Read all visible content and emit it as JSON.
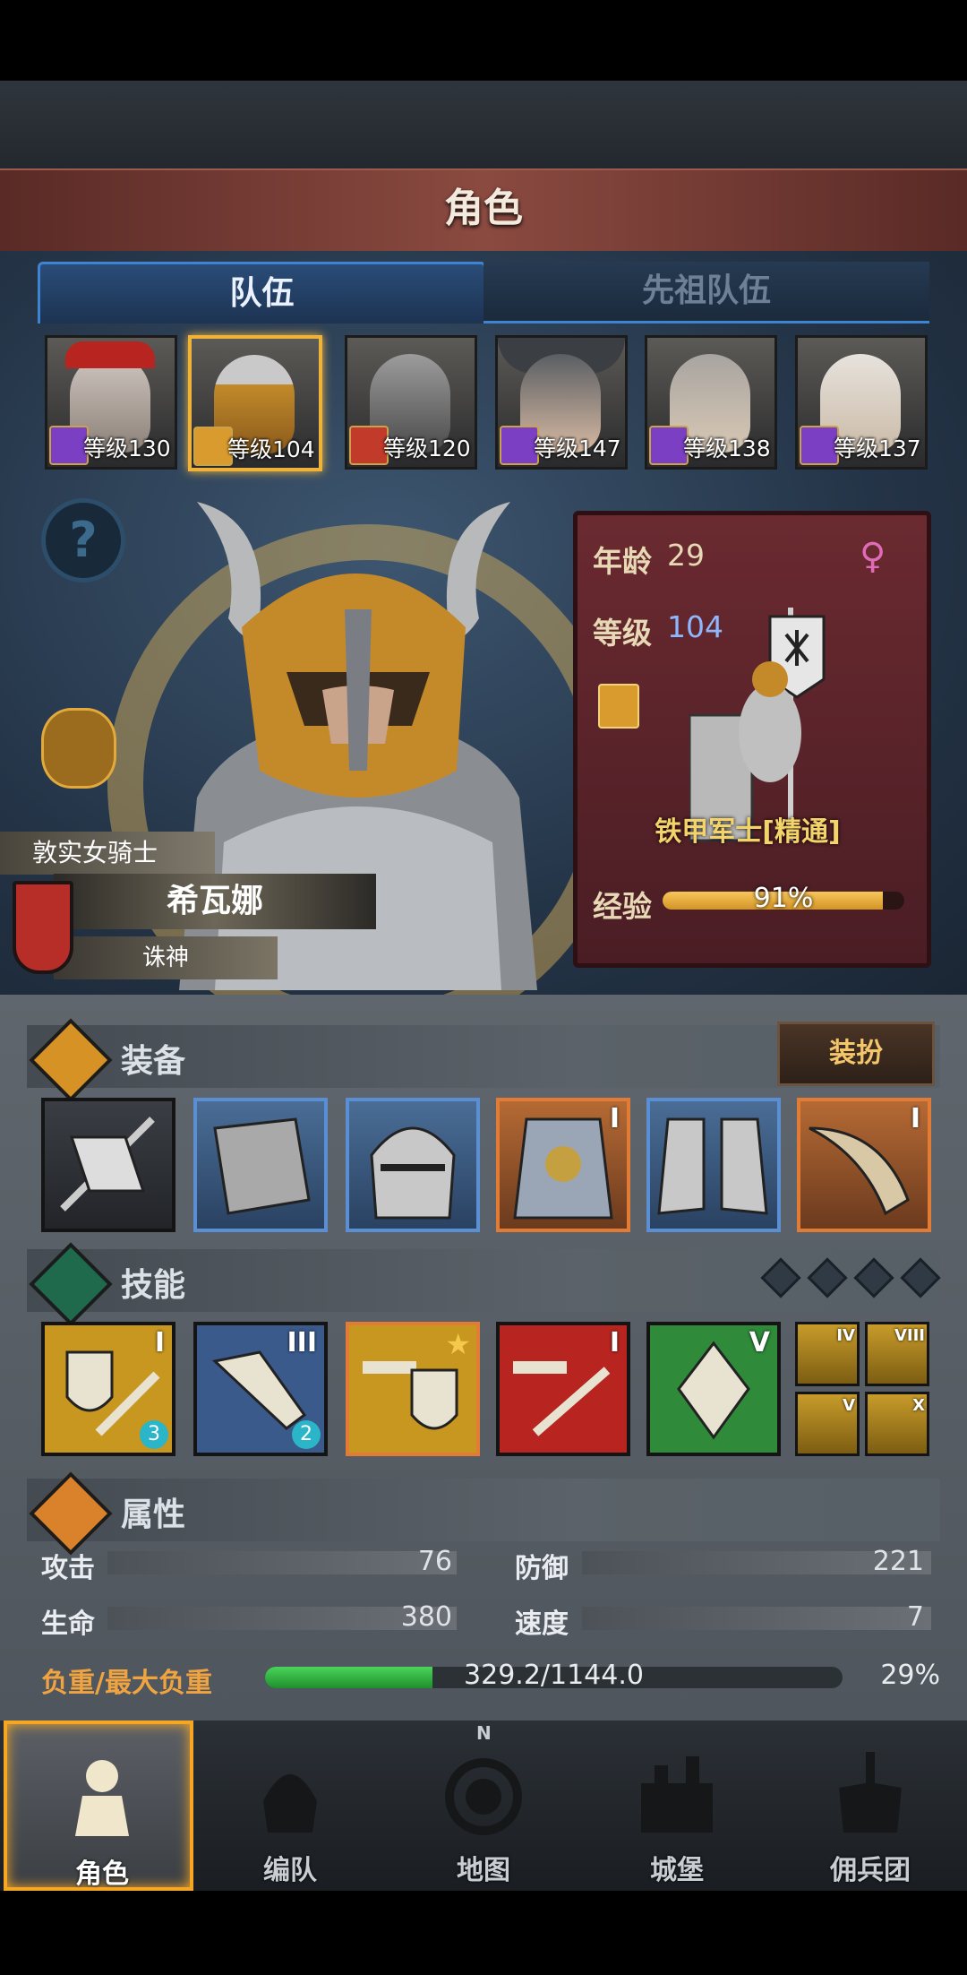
{
  "header": {
    "title": "角色"
  },
  "tabs": [
    {
      "label": "队伍"
    },
    {
      "label": "先祖队伍"
    }
  ],
  "roster": [
    {
      "level": "等级130",
      "class_icon": "staff-icon"
    },
    {
      "level": "等级104",
      "class_icon": "shield-icon",
      "selected": true
    },
    {
      "level": "等级120",
      "class_icon": "horse-icon"
    },
    {
      "level": "等级147",
      "class_icon": "staff-icon"
    },
    {
      "level": "等级138",
      "class_icon": "staff-icon"
    },
    {
      "level": "等级137",
      "class_icon": "staff-icon"
    }
  ],
  "character": {
    "title": "敦实女骑士",
    "name": "希瓦娜",
    "subtitle": "诛神",
    "age_label": "年龄",
    "age": "29",
    "level_label": "等级",
    "level": "104",
    "gender_symbol": "♀",
    "class_name": "铁甲军士[精通]",
    "exp_label": "经验",
    "exp_text": "91%",
    "exp_fraction": 0.91
  },
  "equipment": {
    "title": "装备",
    "dress_button": "装扮",
    "slots": [
      {
        "icon": "banner-icon",
        "rarity": "dark",
        "tier": ""
      },
      {
        "icon": "tower-shield-icon",
        "rarity": "blue",
        "tier": ""
      },
      {
        "icon": "great-helm-icon",
        "rarity": "blue",
        "tier": ""
      },
      {
        "icon": "plate-armor-icon",
        "rarity": "orange",
        "tier": "I"
      },
      {
        "icon": "greaves-icon",
        "rarity": "blue",
        "tier": ""
      },
      {
        "icon": "horn-icon",
        "rarity": "orange",
        "tier": "I"
      }
    ]
  },
  "skills": {
    "title": "技能",
    "items": [
      {
        "icon": "shield-sword-icon",
        "tier": "I",
        "badge": "3",
        "color": "#c7971f"
      },
      {
        "icon": "broken-sword-icon",
        "tier": "III",
        "badge": "2",
        "color": "#3a5a8c"
      },
      {
        "icon": "dumbbell-shield-icon",
        "tier": "",
        "badge": "",
        "color": "#c7971f"
      },
      {
        "icon": "dumbbell-sword-icon",
        "tier": "I",
        "badge": "",
        "color": "#b8241f"
      },
      {
        "icon": "crystal-icon",
        "tier": "V",
        "badge": "",
        "color": "#2f8a3a"
      }
    ],
    "mini": [
      {
        "tier": "IV"
      },
      {
        "tier": "VIII"
      },
      {
        "tier": "V"
      },
      {
        "tier": "X"
      }
    ]
  },
  "attributes": {
    "title": "属性",
    "attack_label": "攻击",
    "attack": "76",
    "defense_label": "防御",
    "defense": "221",
    "hp_label": "生命",
    "hp": "380",
    "speed_label": "速度",
    "speed": "7",
    "load_label": "负重/最大负重",
    "load_text": "329.2/1144.0",
    "load_pct": "29%",
    "load_fraction": 0.29
  },
  "nav": [
    {
      "label": "角色",
      "icon": "knight-icon",
      "active": true
    },
    {
      "label": "编队",
      "icon": "helmet-icon"
    },
    {
      "label": "地图",
      "icon": "compass-icon",
      "compass_n": "N"
    },
    {
      "label": "城堡",
      "icon": "castle-icon"
    },
    {
      "label": "佣兵团",
      "icon": "mercenary-icon"
    }
  ],
  "colors": {
    "accent": "#f5a623",
    "tab_blue": "#3f84d1",
    "level_blue": "#8fb7ff",
    "load_green": "#2fbf3f"
  }
}
